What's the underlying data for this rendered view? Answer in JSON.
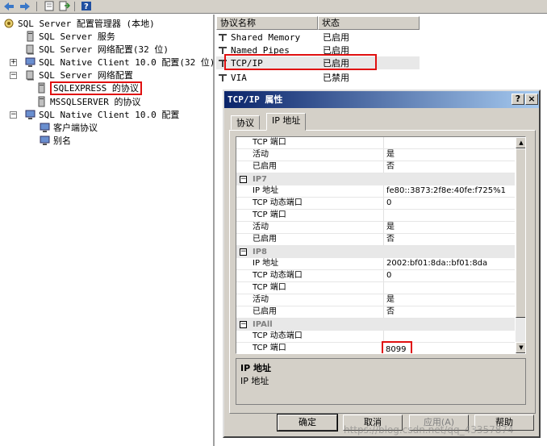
{
  "toolbar": {
    "icons": [
      "back-arrow-icon",
      "forward-arrow-icon",
      "properties-icon",
      "export-icon",
      "help-icon"
    ]
  },
  "tree": {
    "root": "SQL Server 配置管理器 (本地)",
    "items": [
      "SQL Server 服务",
      "SQL Server 网络配置(32 位)",
      "SQL Native Client 10.0 配置(32 位)",
      "SQL Server 网络配置",
      "SQLEXPRESS 的协议",
      "MSSQLSERVER 的协议",
      "SQL Native Client 10.0 配置",
      "客户端协议",
      "别名"
    ]
  },
  "list": {
    "headers": [
      "协议名称",
      "状态"
    ],
    "rows": [
      {
        "name": "Shared Memory",
        "status": "已启用"
      },
      {
        "name": "Named Pipes",
        "status": "已启用"
      },
      {
        "name": "TCP/IP",
        "status": "已启用"
      },
      {
        "name": "VIA",
        "status": "已禁用"
      }
    ]
  },
  "dialog": {
    "title": "TCP/IP 属性",
    "help_btn": "?",
    "close_btn": "×",
    "tabs": [
      "协议",
      "IP 地址"
    ],
    "active_tab": "IP 地址",
    "grid": [
      {
        "type": "row",
        "k": "TCP 端口",
        "v": ""
      },
      {
        "type": "row",
        "k": "活动",
        "v": "是"
      },
      {
        "type": "row",
        "k": "已启用",
        "v": "否"
      },
      {
        "type": "cat",
        "k": "IP7"
      },
      {
        "type": "row",
        "k": "IP 地址",
        "v": "fe80::3873:2f8e:40fe:f725%1"
      },
      {
        "type": "row",
        "k": "TCP 动态端口",
        "v": "0"
      },
      {
        "type": "row",
        "k": "TCP 端口",
        "v": ""
      },
      {
        "type": "row",
        "k": "活动",
        "v": "是"
      },
      {
        "type": "row",
        "k": "已启用",
        "v": "否"
      },
      {
        "type": "cat",
        "k": "IP8"
      },
      {
        "type": "row",
        "k": "IP 地址",
        "v": "2002:bf01:8da::bf01:8da"
      },
      {
        "type": "row",
        "k": "TCP 动态端口",
        "v": "0"
      },
      {
        "type": "row",
        "k": "TCP 端口",
        "v": ""
      },
      {
        "type": "row",
        "k": "活动",
        "v": "是"
      },
      {
        "type": "row",
        "k": "已启用",
        "v": "否"
      },
      {
        "type": "cat",
        "k": "IPAll"
      },
      {
        "type": "row",
        "k": "TCP 动态端口",
        "v": ""
      },
      {
        "type": "row",
        "k": "TCP 端口",
        "v": "8099"
      }
    ],
    "desc_title": "IP 地址",
    "desc_text": "IP 地址",
    "buttons": {
      "ok": "确定",
      "cancel": "取消",
      "apply": "应用(A)",
      "help": "帮助"
    }
  },
  "watermark": "https://blog.csdn.net/qq_43357874",
  "colors": {
    "highlight": "#e01010",
    "titlebar": "#0a246a"
  }
}
